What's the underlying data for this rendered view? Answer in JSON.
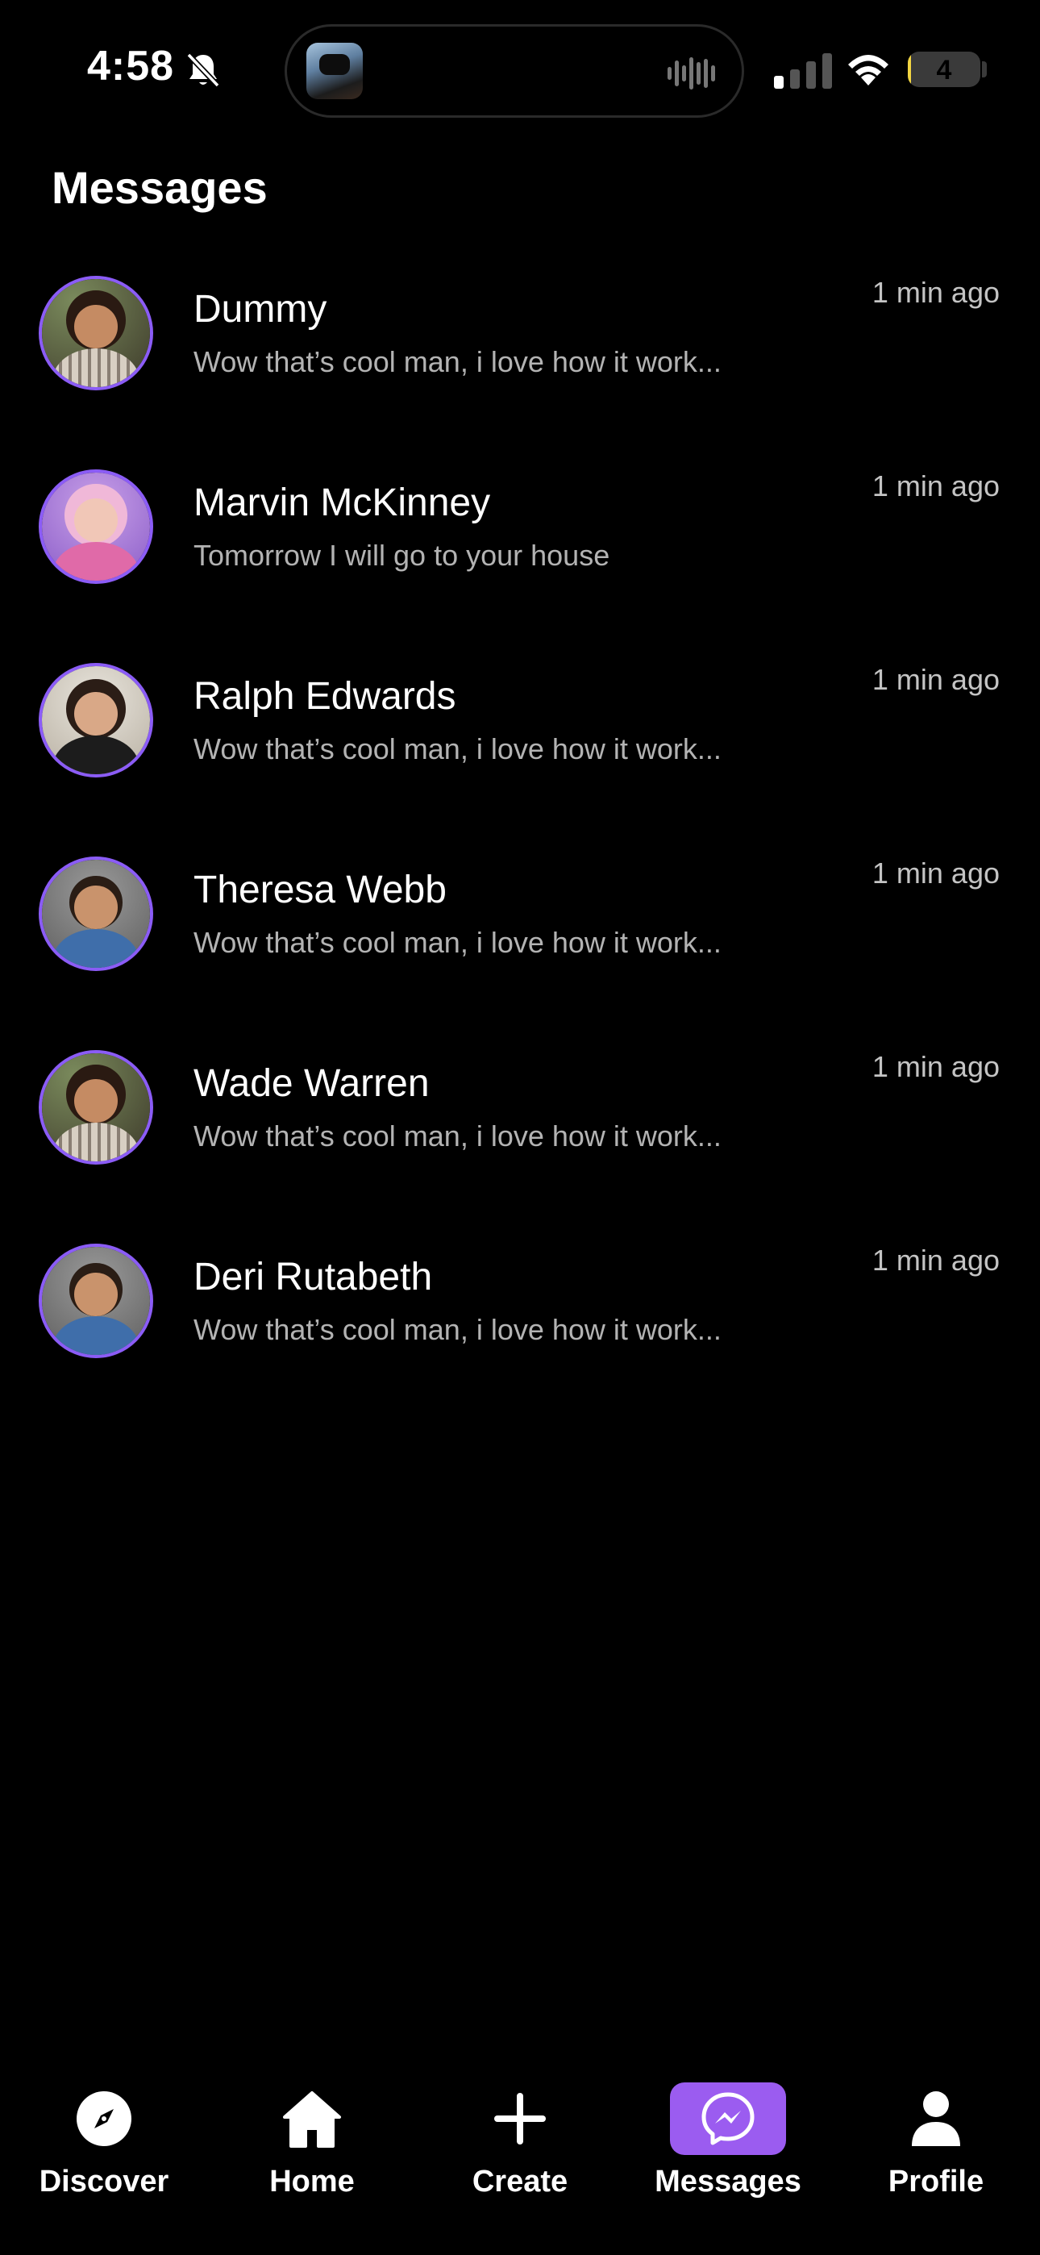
{
  "status_bar": {
    "time": "4:58",
    "battery_level": "4",
    "battery_fraction": 0.04
  },
  "header": {
    "title": "Messages"
  },
  "messages": [
    {
      "name": "Dummy",
      "preview": "Wow that’s cool man, i love how it work...",
      "time": "1 min ago",
      "avatar": "woman-curly-hair"
    },
    {
      "name": "Marvin McKinney",
      "preview": "Tomorrow I will go to your house",
      "time": "1 min ago",
      "avatar": "woman-pink-hair"
    },
    {
      "name": "Ralph Edwards",
      "preview": "Wow that’s cool man, i love how it work...",
      "time": "1 min ago",
      "avatar": "woman-dark-hair"
    },
    {
      "name": "Theresa Webb",
      "preview": "Wow that’s cool man, i love how it work...",
      "time": "1 min ago",
      "avatar": "man-denim-shirt"
    },
    {
      "name": "Wade Warren",
      "preview": "Wow that’s cool man, i love how it work...",
      "time": "1 min ago",
      "avatar": "woman-curly-hair"
    },
    {
      "name": "Deri Rutabeth",
      "preview": "Wow that’s cool man, i love how it work...",
      "time": "1 min ago",
      "avatar": "man-denim-shirt"
    }
  ],
  "bottom_nav": {
    "items": [
      {
        "label": "Discover",
        "icon": "compass-icon"
      },
      {
        "label": "Home",
        "icon": "home-icon"
      },
      {
        "label": "Create",
        "icon": "plus-icon"
      },
      {
        "label": "Messages",
        "icon": "messenger-icon",
        "active": true
      },
      {
        "label": "Profile",
        "icon": "person-icon"
      }
    ]
  },
  "colors": {
    "background": "#000000",
    "accent": "#9b5cf0",
    "avatar_ring": "#8b5cf6",
    "text_primary": "#ffffff",
    "text_secondary": "#b3b3b3"
  }
}
